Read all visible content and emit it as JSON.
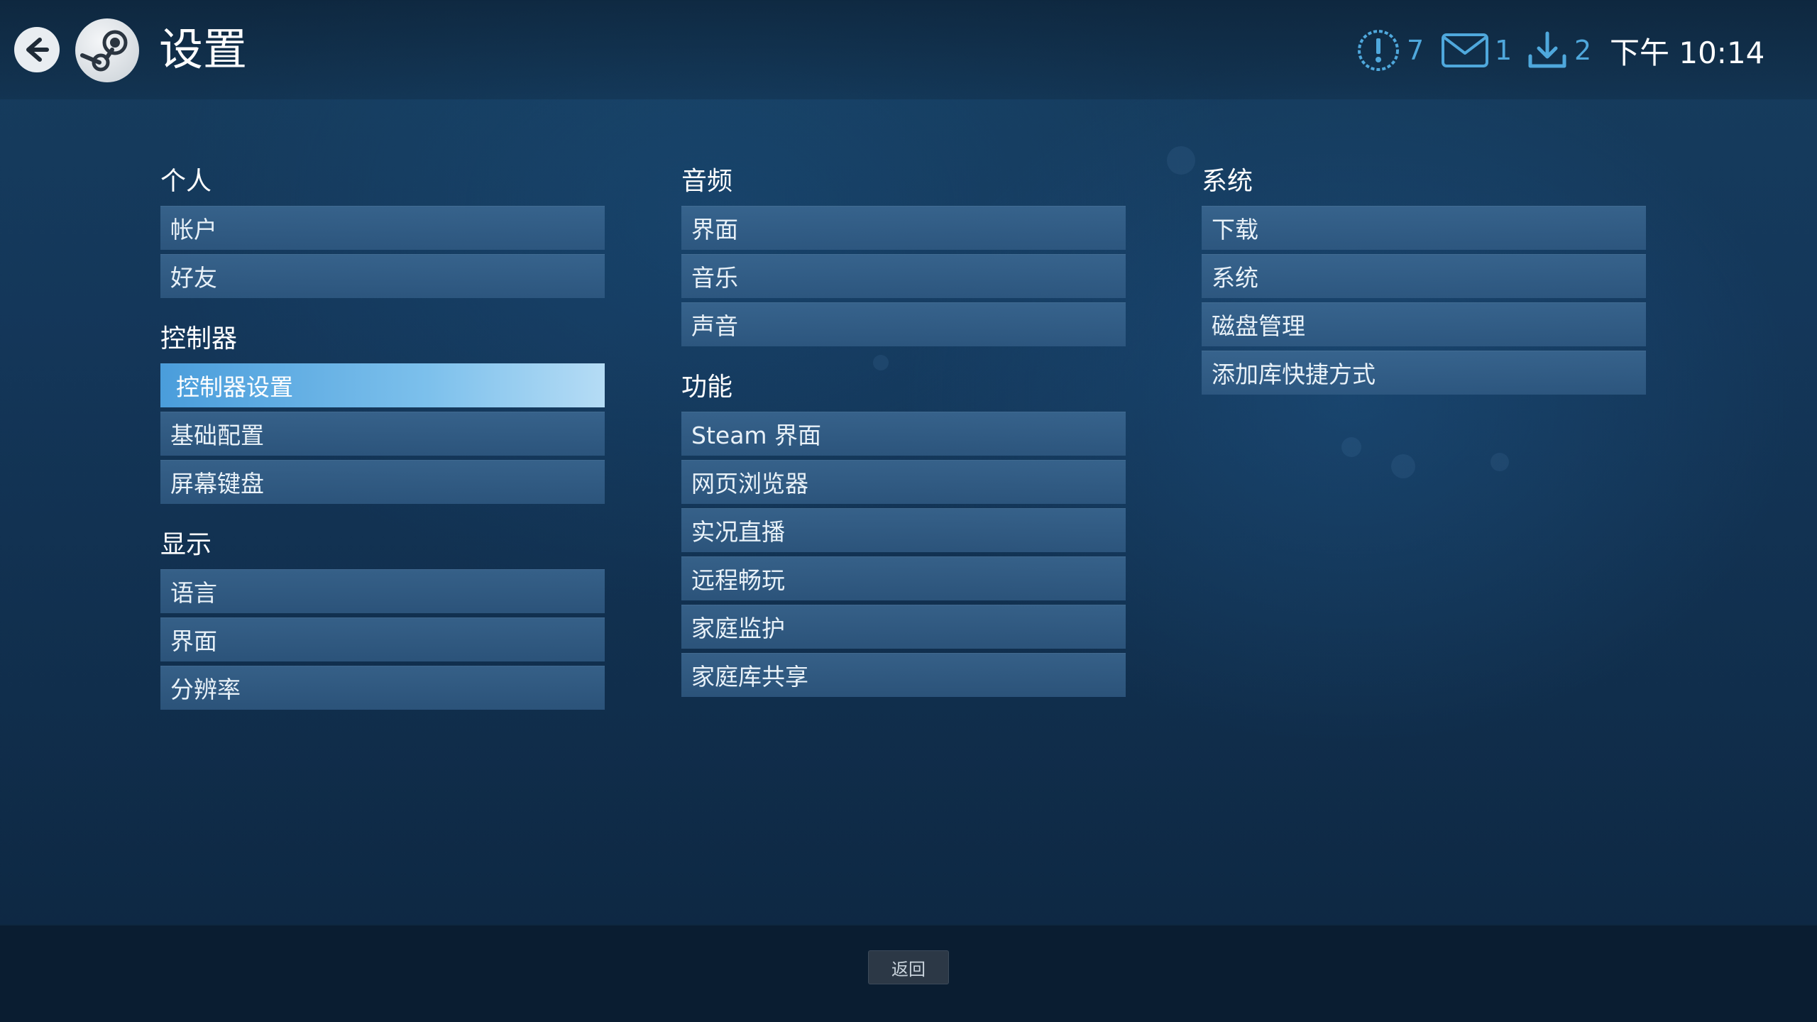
{
  "header": {
    "title": "设置",
    "alerts_count": "7",
    "messages_count": "1",
    "downloads_count": "2",
    "clock": "下午 10:14"
  },
  "columns": [
    {
      "sections": [
        {
          "title": "个人",
          "items": [
            "帐户",
            "好友"
          ]
        },
        {
          "title": "控制器",
          "items": [
            "控制器设置",
            "基础配置",
            "屏幕键盘"
          ]
        },
        {
          "title": "显示",
          "items": [
            "语言",
            "界面",
            "分辨率"
          ]
        }
      ]
    },
    {
      "sections": [
        {
          "title": "音频",
          "items": [
            "界面",
            "音乐",
            "声音"
          ]
        },
        {
          "title": "功能",
          "items": [
            "Steam 界面",
            "网页浏览器",
            "实况直播",
            "远程畅玩",
            "家庭监护",
            "家庭库共享"
          ]
        }
      ]
    },
    {
      "sections": [
        {
          "title": "系统",
          "items": [
            "下载",
            "系统",
            "磁盘管理",
            "添加库快捷方式"
          ]
        }
      ]
    }
  ],
  "selected_item": "控制器设置",
  "footer": {
    "back_label": "返回"
  },
  "colors": {
    "accent": "#4fa8dc",
    "selected_bg": "#7cc0ec",
    "item_bg": "#3f6c96"
  }
}
